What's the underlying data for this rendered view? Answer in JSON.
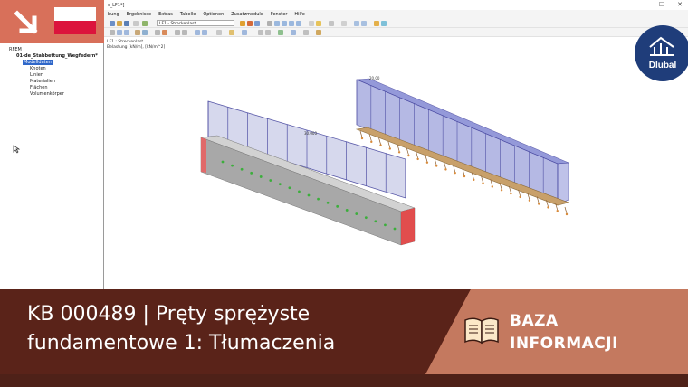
{
  "window": {
    "title": "s_LF1*]",
    "controls": [
      "–",
      "☐",
      "✕"
    ]
  },
  "menu": {
    "items": [
      "bung",
      "Ergebnisse",
      "Extras",
      "Tabelle",
      "Optionen",
      "Zusatzmodule",
      "Fenster",
      "Hilfe"
    ]
  },
  "toolbar": {
    "load_case": "LF1 - Streckenlast"
  },
  "navigator": {
    "root": "RFEM",
    "project": "01-de_Stabbettung_Wegfedern*",
    "selected": "Modelldaten",
    "children": [
      "Knoten",
      "Linien",
      "Materialien",
      "Flächen",
      "Volumenkörper"
    ]
  },
  "view": {
    "line1": "LF1 : Streckenlast",
    "line2": "Belastung [kN/m], [kN/m^2]",
    "load_value_left": "30.000",
    "load_value_right": "20.00"
  },
  "banner": {
    "title_line1": "KB 000489 | Pręty sprężyste",
    "title_line2": "fundamentowe 1: Tłumaczenia",
    "section_line1": "BAZA",
    "section_line2": "INFORMACJI"
  },
  "logo": {
    "text": "Dlubal"
  },
  "colors": {
    "banner": "#c4795f",
    "banner_dark": "#5a2319",
    "accent": "#2f67c9",
    "flag_red": "#dc143c",
    "logo_blue": "#1f3d7a"
  }
}
